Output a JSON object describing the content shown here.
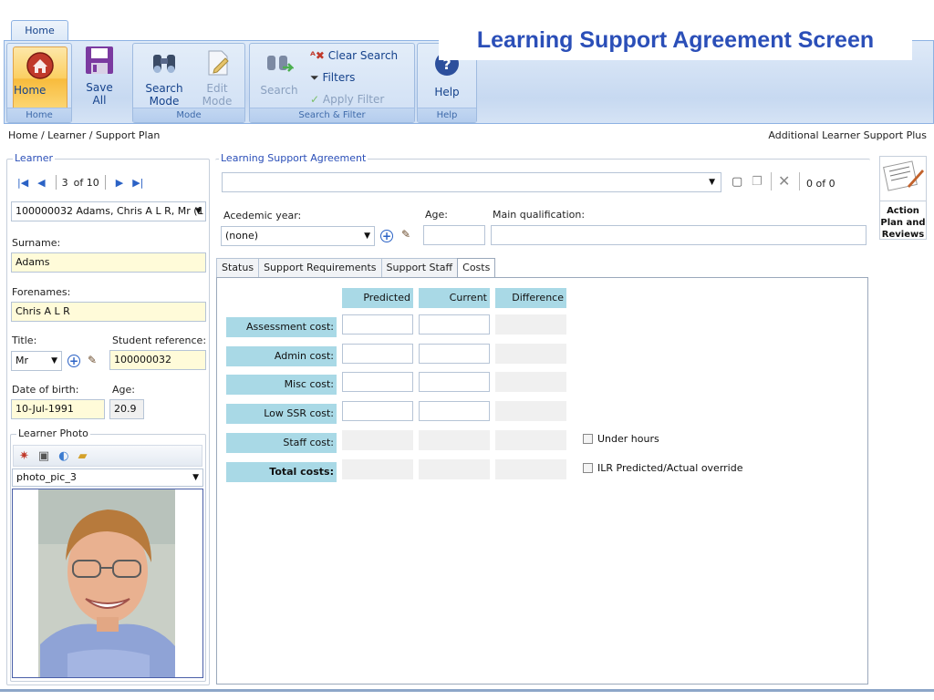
{
  "ribbon": {
    "tab_home": "Home",
    "home_label": "Home",
    "save_label": "Save\nAll",
    "search_mode_label": "Search\nMode",
    "edit_mode_label": "Edit\nMode",
    "search_label": "Search",
    "clear_search_label": "Clear Search",
    "filters_label": "Filters",
    "apply_filter_label": "Apply Filter",
    "help_label": "Help",
    "groups": {
      "home": "Home",
      "mode": "Mode",
      "search_filter": "Search & Filter",
      "help": "Help"
    }
  },
  "slide_title": "Learning Support Agreement Screen",
  "breadcrumb": "Home / Learner / Support Plan",
  "header_right": "Additional Learner Support Plus",
  "learner": {
    "legend": "Learner",
    "nav_position": "3",
    "nav_total": "of 10",
    "selected": "100000032 Adams, Chris A L R, Mr (1",
    "surname_label": "Surname:",
    "surname": "Adams",
    "forenames_label": "Forenames:",
    "forenames": "Chris A L R",
    "title_label": "Title:",
    "title": "Mr",
    "student_ref_label": "Student reference:",
    "student_ref": "100000032",
    "dob_label": "Date of birth:",
    "dob": "10-Jul-1991",
    "age_label": "Age:",
    "age": "20.9",
    "photo_legend": "Learner Photo",
    "photo_select": "photo_pic_3"
  },
  "agreement": {
    "legend": "Learning Support Agreement",
    "record_count": "0  of 0",
    "academic_year_label": "Acedemic year:",
    "academic_year": "(none)",
    "age_label": "Age:",
    "main_qual_label": "Main qualification:"
  },
  "tabs": [
    "Status",
    "Support Requirements",
    "Support Staff",
    "Costs"
  ],
  "costs": {
    "headers": [
      "Predicted",
      "Current",
      "Difference"
    ],
    "rows": [
      "Assessment cost:",
      "Admin cost:",
      "Misc cost:",
      "Low SSR cost:",
      "Staff cost:",
      "Total costs:"
    ],
    "under_hours": "Under hours",
    "ilr_override": "ILR Predicted/Actual override"
  },
  "action_panel": {
    "label_1": "Action",
    "label_2": "Plan and",
    "label_3": "Reviews"
  }
}
